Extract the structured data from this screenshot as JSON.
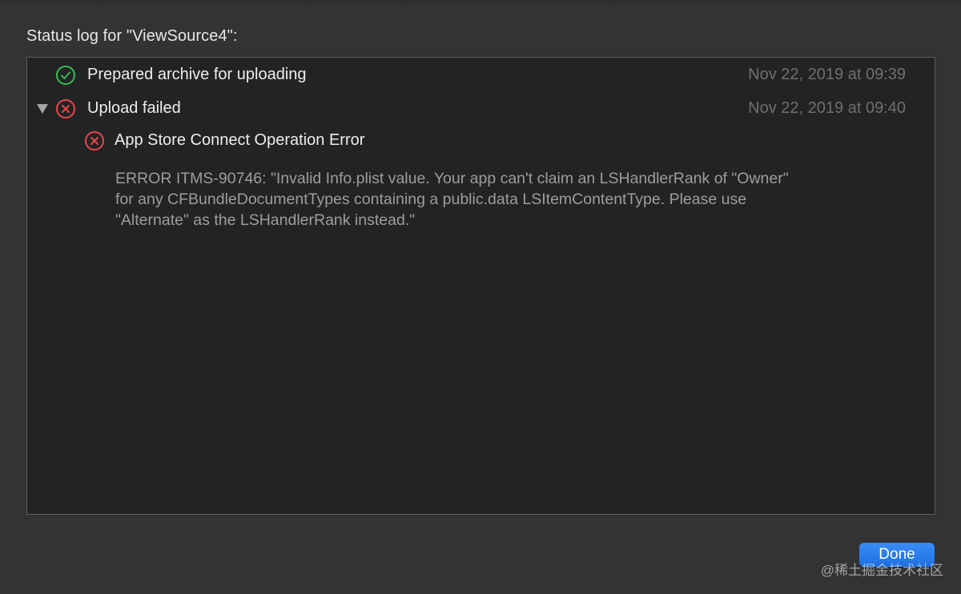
{
  "dialog": {
    "title": "Status log for \"ViewSource4\":"
  },
  "log": {
    "entries": [
      {
        "status": "success",
        "icon": "checkmark-circle-icon",
        "title": "Prepared archive for uploading",
        "timestamp": "Nov 22, 2019 at 09:39"
      },
      {
        "status": "error",
        "icon": "x-circle-icon",
        "expanded": true,
        "title": "Upload failed",
        "timestamp": "Nov 22, 2019 at 09:40",
        "children": [
          {
            "status": "error",
            "icon": "x-circle-icon",
            "title": "App Store Connect Operation Error",
            "message_lines": [
              "ERROR ITMS-90746: \"Invalid Info.plist value. Your app can't claim an LSHandlerRank of \"Owner\"",
              "for any CFBundleDocumentTypes containing a public.data LSItemContentType. Please use",
              "\"Alternate\" as the LSHandlerRank instead.\""
            ]
          }
        ]
      }
    ]
  },
  "footer": {
    "done_label": "Done",
    "watermark": "@稀土掘金技术社区"
  },
  "colors": {
    "success": "#30c04e",
    "error": "#e8484b",
    "accent": "#1f6ee0"
  }
}
